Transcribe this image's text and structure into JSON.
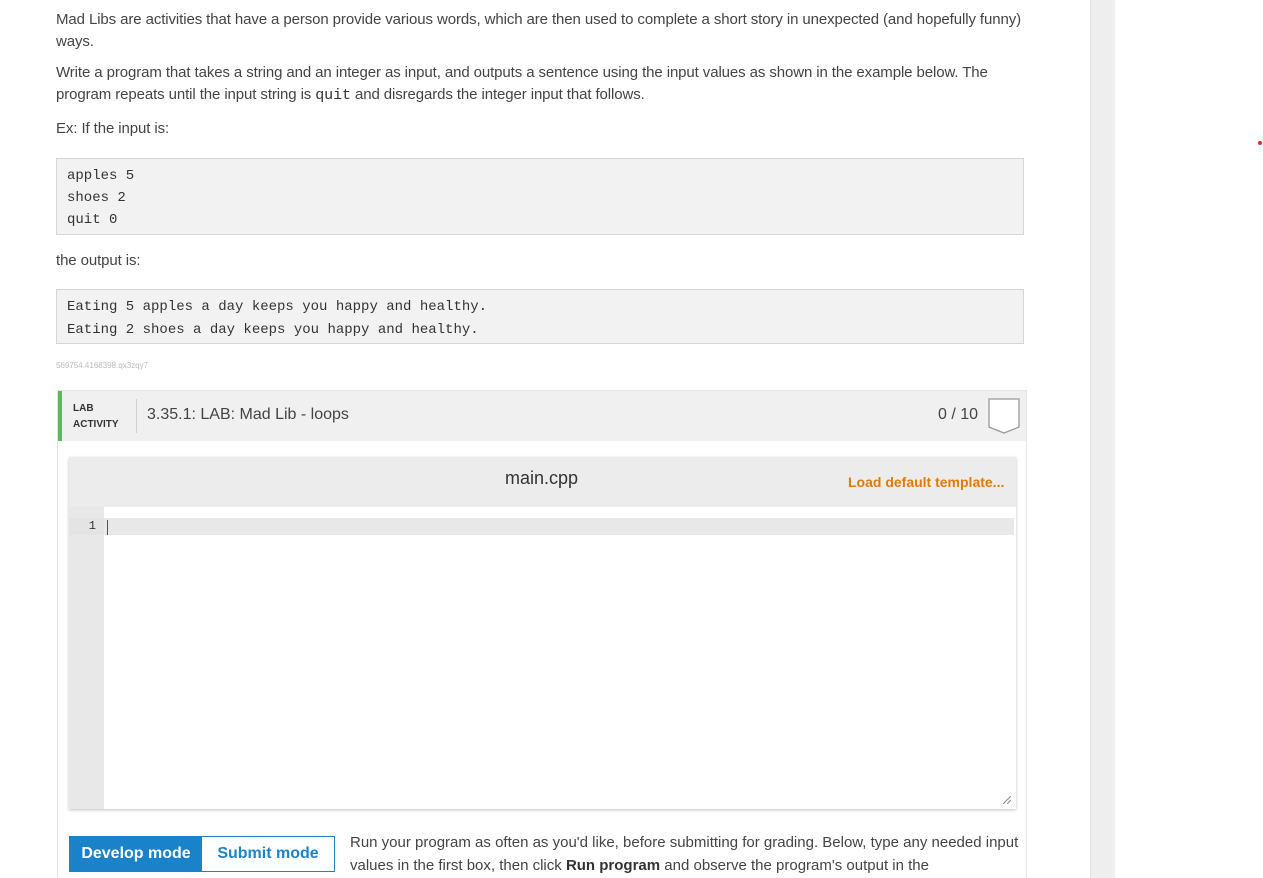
{
  "intro": {
    "p1": "Mad Libs are activities that have a person provide various words, which are then used to complete a short story in unexpected (and hopefully funny) ways.",
    "p2_before": "Write a program that takes a string and an integer as input, and outputs a sentence using the input values as shown in the example below. The program repeats until the input string is ",
    "p2_code": "quit",
    "p2_after": " and disregards the integer input that follows.",
    "ex_label": "Ex: If the input is:",
    "input_lines": [
      "apples 5",
      "shoes 2",
      "quit 0"
    ],
    "output_label": "the output is:",
    "output_lines": [
      "Eating 5 apples a day keeps you happy and healthy.",
      "Eating 2 shoes a day keeps you happy and healthy."
    ]
  },
  "activity_id": "569754.4168398.qx3zqy7",
  "lab": {
    "tag_line1": "LAB",
    "tag_line2": "ACTIVITY",
    "title": "3.35.1: LAB: Mad Lib - loops",
    "score": "0 / 10",
    "accent_color": "#5cb85c"
  },
  "editor": {
    "filename": "main.cpp",
    "load_template": "Load default template...",
    "line_numbers": [
      "1"
    ]
  },
  "modes": {
    "develop": "Develop mode",
    "submit": "Submit mode",
    "active": "develop",
    "accent_color": "#1a82c8"
  },
  "help": {
    "text_before": "Run your program as often as you'd like, before submitting for grading. Below, type any needed input values in the first box, then click ",
    "run_program": "Run program",
    "text_after": " and observe the program's output in the"
  }
}
